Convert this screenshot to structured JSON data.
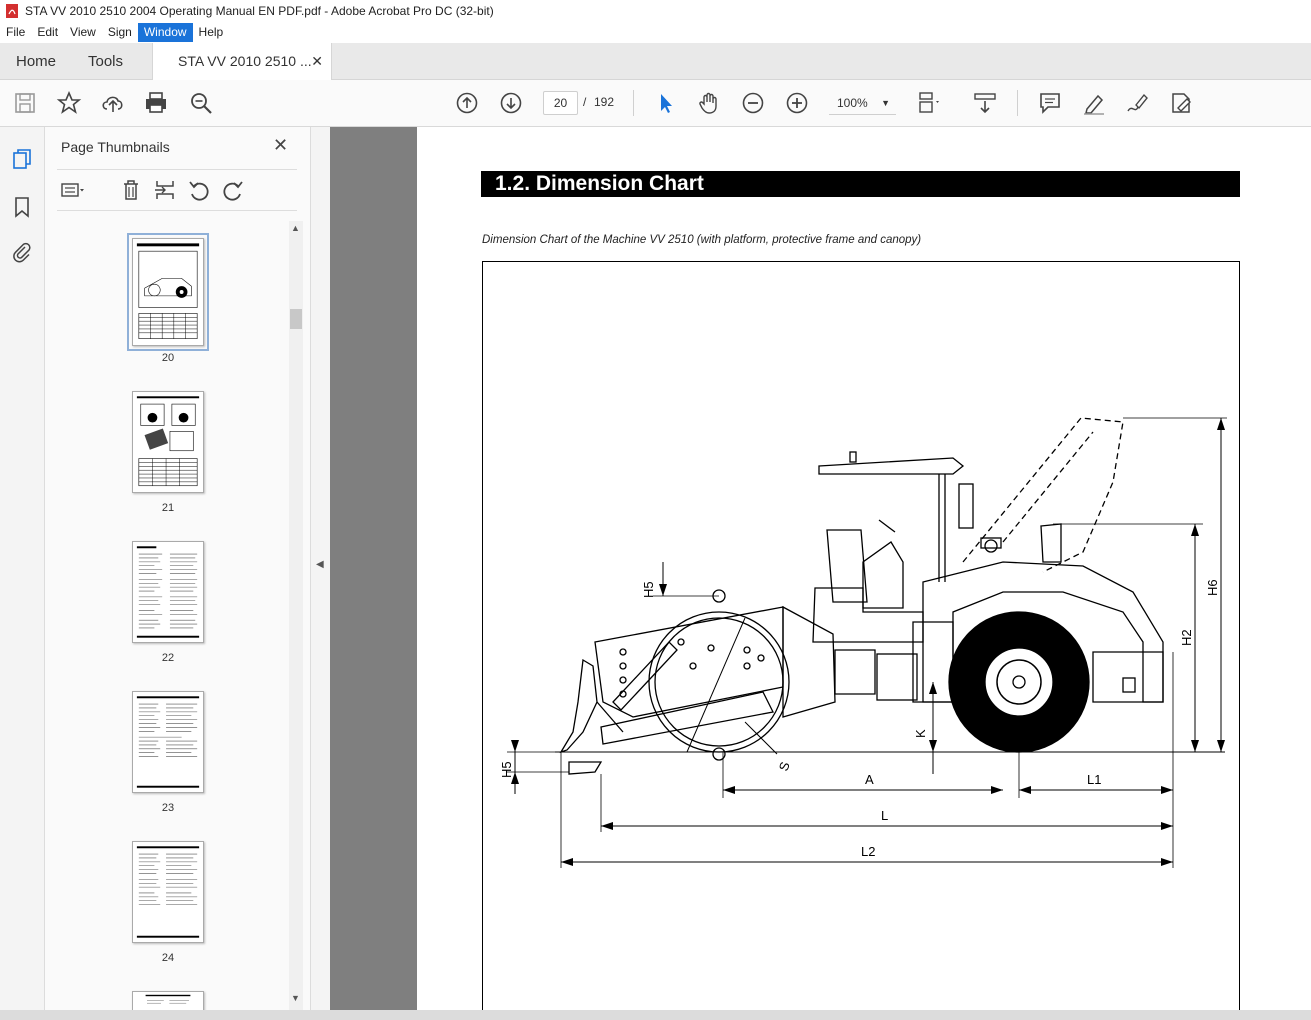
{
  "window": {
    "title": "STA VV 2010 2510 2004 Operating Manual EN PDF.pdf - Adobe Acrobat Pro DC (32-bit)"
  },
  "menu": {
    "items": [
      "File",
      "Edit",
      "View",
      "Sign",
      "Window",
      "Help"
    ],
    "active": "Window"
  },
  "tabs": {
    "home": "Home",
    "tools": "Tools",
    "document": "STA VV 2010 2510 ..."
  },
  "toolbar": {
    "current_page": "20",
    "separator": "/",
    "total_pages": "192",
    "zoom": "100%"
  },
  "thumbnails": {
    "title": "Page Thumbnails",
    "pages": [
      "20",
      "21",
      "22",
      "23",
      "24"
    ],
    "selected": "20"
  },
  "document": {
    "section_title": "1.2.  Dimension Chart",
    "caption": "Dimension Chart of the Machine VV 2510 (with platform, protective frame and canopy)",
    "dimension_labels": {
      "h5_top": "H5",
      "h5_left": "H5",
      "s": "S",
      "k": "K",
      "a": "A",
      "l1": "L1",
      "l": "L",
      "l2": "L2",
      "h2": "H2",
      "h6": "H6"
    }
  },
  "colors": {
    "menu_active": "#1a73d9",
    "doc_background": "#7f7f7f",
    "banner": "#000000"
  }
}
